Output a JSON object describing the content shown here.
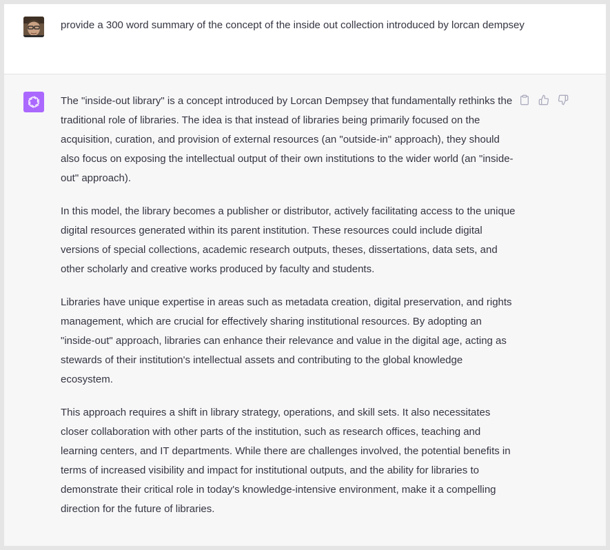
{
  "user_message": {
    "avatar": "user-photo",
    "text": "provide a 300 word summary of the concept of the inside out collection introduced by lorcan dempsey"
  },
  "assistant_message": {
    "avatar": "openai-logo-icon",
    "avatar_color": "#ab68ff",
    "paragraphs": [
      "The \"inside-out library\" is a concept introduced by Lorcan Dempsey that fundamentally rethinks the traditional role of libraries. The idea is that instead of libraries being primarily focused on the acquisition, curation, and provision of external resources (an \"outside-in\" approach), they should also focus on exposing the intellectual output of their own institutions to the wider world (an \"inside-out\" approach).",
      "In this model, the library becomes a publisher or distributor, actively facilitating access to the unique digital resources generated within its parent institution. These resources could include digital versions of special collections, academic research outputs, theses, dissertations, data sets, and other scholarly and creative works produced by faculty and students.",
      "Libraries have unique expertise in areas such as metadata creation, digital preservation, and rights management, which are crucial for effectively sharing institutional resources. By adopting an \"inside-out\" approach, libraries can enhance their relevance and value in the digital age, acting as stewards of their institution's intellectual assets and contributing to the global knowledge ecosystem.",
      "This approach requires a shift in library strategy, operations, and skill sets. It also necessitates closer collaboration with other parts of the institution, such as research offices, teaching and learning centers, and IT departments. While there are challenges involved, the potential benefits in terms of increased visibility and impact for institutional outputs, and the ability for libraries to demonstrate their critical role in today's knowledge-intensive environment, make it a compelling direction for the future of libraries."
    ],
    "actions": [
      "clipboard-icon",
      "thumbs-up-icon",
      "thumbs-down-icon"
    ]
  },
  "colors": {
    "text": "#343541",
    "assistant_bg": "#f7f7f8",
    "user_bg": "#ffffff",
    "icon": "#acacbe"
  }
}
